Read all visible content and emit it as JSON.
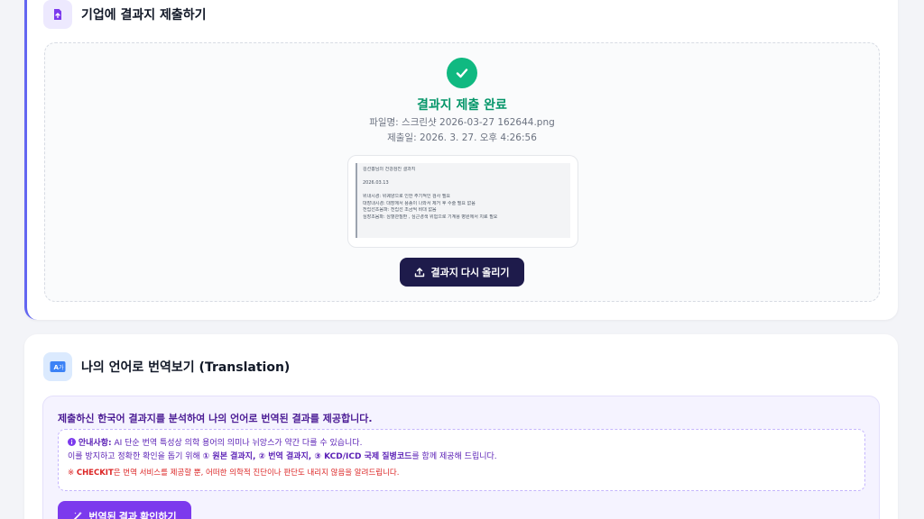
{
  "submit_section": {
    "title": "기업에 결과지 제출하기",
    "status_title": "결과지 제출 완료",
    "file_line": "파일명: 스크린샷 2026-03-27 162644.png",
    "date_line": "제출일: 2026. 3. 27. 오후 4:26:56",
    "preview_lines": [
      "김선홍님의 건강검진 결과지",
      "",
      "2026.03.13",
      "",
      "위내시경: 위궤양으로 인한 주기적인 검사 필요",
      "대장내시경: 대장에서 용종이 나와서 제거 후 수술 필요 없음",
      "전립선초음파: 전립선 조금씩 비대 없음",
      "심장초음파: 심혈관질환 , 심근경색 위험으로 기계용 병원에서 치료 필요"
    ],
    "reupload_label": "결과지 다시 올리기"
  },
  "translation_section": {
    "title": "나의 언어로 번역보기 (Translation)",
    "intro": "제출하신 한국어 결과지를 분석하여 나의 언어로 번역된 결과를 제공합니다.",
    "notice_label": "안내사항:",
    "notice_text": " AI 단순 번역 특성상 의학 용어의 의미나 뉘앙스가 약간 다를 수 있습니다.",
    "notice_line2_prefix": "이를 방지하고 정확한 확인을 돕기 위해 ",
    "notice_line2_bold": "① 원본 결과지, ② 번역 결과지, ③ KCD/ICD 국제 질병코드",
    "notice_line2_suffix": "를 함께 제공해 드립니다.",
    "warning_prefix": "※ ",
    "warning_bold": "CHECKIT",
    "warning_text": "은 번역 서비스를 제공할 뿐, 어떠한 의학적 진단이나 판단도 내리지 않음을 알려드립니다.",
    "button_label": "번역된 결과 확인하기"
  },
  "colors": {
    "accent_purple": "#7c3aed",
    "success_green": "#10b981",
    "navy_button": "#1e1b4b",
    "warning_red": "#dc2626"
  }
}
